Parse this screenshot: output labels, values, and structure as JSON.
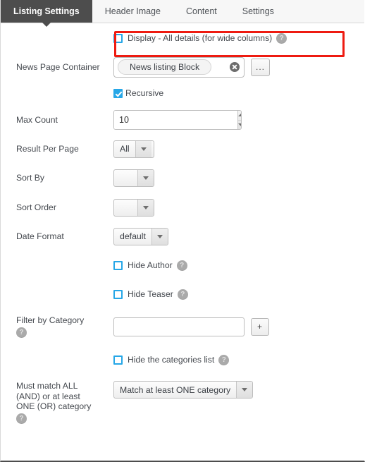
{
  "tabs": [
    {
      "label": "Listing Settings",
      "active": true
    },
    {
      "label": "Header Image",
      "active": false
    },
    {
      "label": "Content",
      "active": false
    },
    {
      "label": "Settings",
      "active": false
    }
  ],
  "annotation": {
    "color": "#ee1b11",
    "target": "display-all-details-row"
  },
  "form": {
    "display_all_details": {
      "label": "Display - All details (for wide columns)",
      "checked": false,
      "help": "?"
    },
    "news_page_container": {
      "label": "News Page Container",
      "chip": "News listing Block",
      "clear_icon": "clear-icon",
      "browse_button": "...",
      "recursive": {
        "label": "Recursive",
        "checked": true
      }
    },
    "max_count": {
      "label": "Max Count",
      "value": "10"
    },
    "result_per_page": {
      "label": "Result Per Page",
      "value": "All"
    },
    "sort_by": {
      "label": "Sort By",
      "value": ""
    },
    "sort_order": {
      "label": "Sort Order",
      "value": ""
    },
    "date_format": {
      "label": "Date Format",
      "value": "default"
    },
    "hide_author": {
      "label": "Hide Author",
      "checked": false,
      "help": "?"
    },
    "hide_teaser": {
      "label": "Hide Teaser",
      "checked": false,
      "help": "?"
    },
    "filter_by_category": {
      "label": "Filter by Category",
      "help": "?",
      "value": "",
      "placeholder": "",
      "add_button": "+"
    },
    "hide_categories_list": {
      "label": "Hide the categories list",
      "checked": false,
      "help": "?"
    },
    "match_mode": {
      "label": "Must match ALL (AND) or at least ONE (OR) category",
      "help": "?",
      "value": "Match at least ONE category"
    }
  }
}
